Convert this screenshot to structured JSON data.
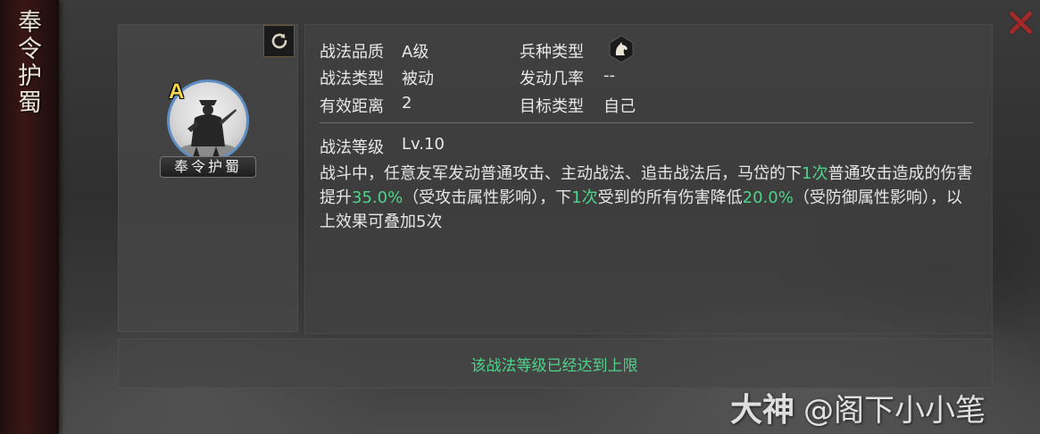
{
  "left_banner": {
    "title": "奉令护蜀"
  },
  "skill": {
    "name": "奉令护蜀",
    "grade_badge": "A"
  },
  "attributes": {
    "quality_label": "战法品质",
    "quality_value": "A级",
    "troop_label": "兵种类型",
    "troop_icon": "horse-head-icon",
    "type_label": "战法类型",
    "type_value": "被动",
    "trigger_label": "发动几率",
    "trigger_value": "--",
    "range_label": "有效距离",
    "range_value": "2",
    "target_label": "目标类型",
    "target_value": "自己"
  },
  "level": {
    "label": "战法等级",
    "value": "Lv.10"
  },
  "description": {
    "p1": "战斗中，任意友军发动普通攻击、主动战法、追击战法后，马岱的下",
    "h1": "1次",
    "p2": "普通攻击造成的伤害提升",
    "h2": "35.0%",
    "p3": "（受攻击属性影响），下",
    "h3": "1次",
    "p4": "受到的所有伤害降低",
    "h4": "20.0%",
    "p5": "（受防御属性影响），以上效果可叠加5次"
  },
  "footer": {
    "message": "该战法等级已经达到上限"
  },
  "watermark": {
    "brand": "大神",
    "handle": "@阁下小小笔"
  },
  "colors": {
    "highlight": "#4fd38a",
    "grade": "#f6d64b",
    "close": "#a32a2a",
    "avatar_ring": "#5e8ec4"
  }
}
